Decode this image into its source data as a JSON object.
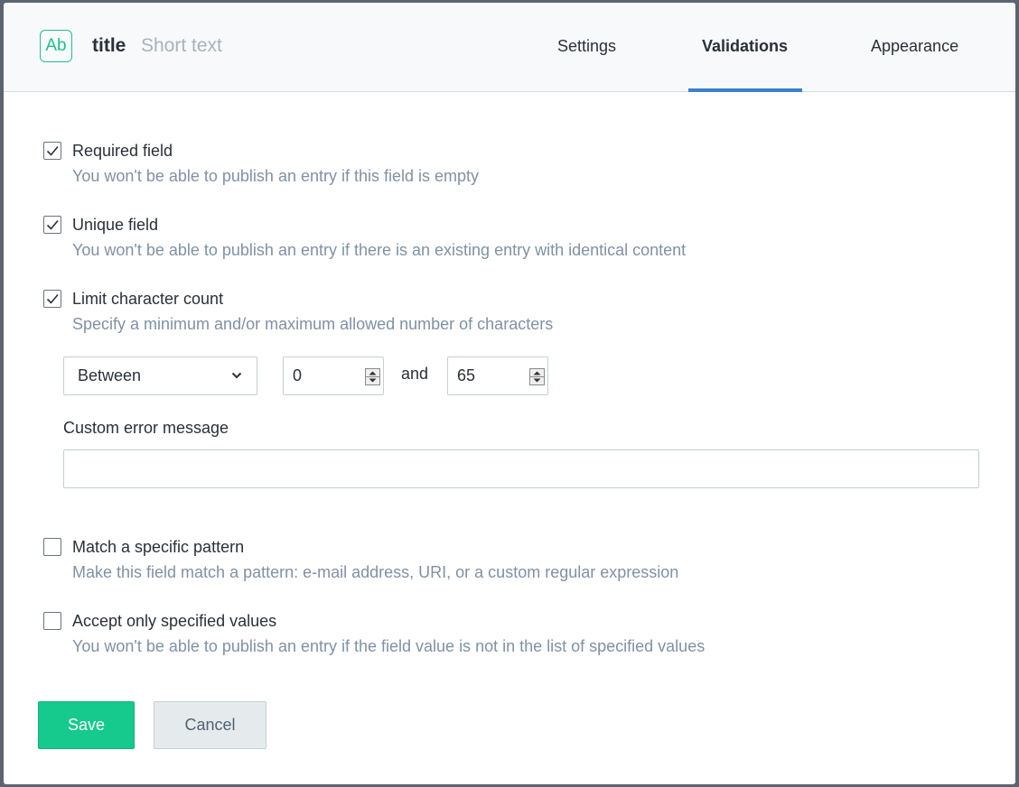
{
  "header": {
    "icon_text": "Ab",
    "field_name": "title",
    "field_type": "Short text",
    "tabs": [
      {
        "label": "Settings",
        "active": false
      },
      {
        "label": "Validations",
        "active": true
      },
      {
        "label": "Appearance",
        "active": false
      }
    ]
  },
  "validations": [
    {
      "label": "Required field",
      "help": "You won't be able to publish an entry if this field is empty",
      "checked": true
    },
    {
      "label": "Unique field",
      "help": "You won't be able to publish an entry if there is an existing entry with identical content",
      "checked": true
    },
    {
      "label": "Limit character count",
      "help": "Specify a minimum and/or maximum allowed number of characters",
      "checked": true
    },
    {
      "label": "Match a specific pattern",
      "help": "Make this field match a pattern: e-mail address, URI, or a custom regular expression",
      "checked": false
    },
    {
      "label": "Accept only specified values",
      "help": "You won't be able to publish an entry if the field value is not in the list of specified values",
      "checked": false
    }
  ],
  "char_limit": {
    "mode": "Between",
    "min": "0",
    "and_label": "and",
    "max": "65",
    "custom_error_label": "Custom error message",
    "custom_error_value": ""
  },
  "footer": {
    "save_label": "Save",
    "cancel_label": "Cancel"
  },
  "colors": {
    "accent_green": "#16c98d",
    "tab_underline": "#3c80cf",
    "help_text": "#8091a5"
  }
}
